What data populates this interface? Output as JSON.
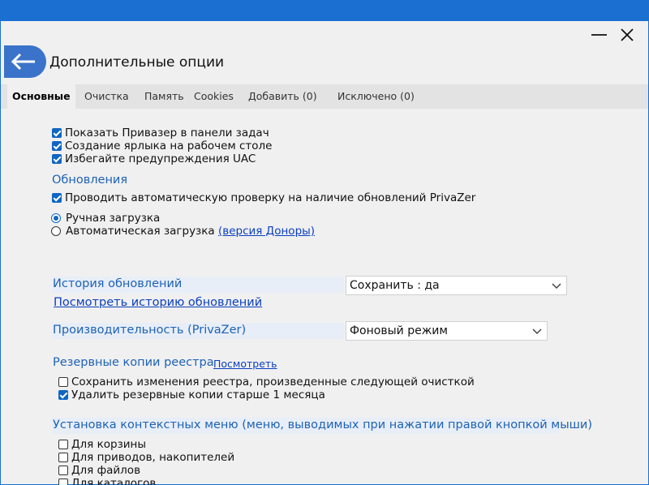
{
  "window": {
    "minimize_icon": "minimize-icon",
    "close_icon": "close-icon"
  },
  "header": {
    "title": "Дополнительные опции",
    "back_icon": "arrow-left-icon"
  },
  "tabs": [
    {
      "label": "Основные",
      "active": true
    },
    {
      "label": "Очистка"
    },
    {
      "label": "Память"
    },
    {
      "label": "Cookies"
    },
    {
      "label": "Добавить (0)"
    },
    {
      "label": "Исключено (0)"
    }
  ],
  "general": {
    "show_taskbar": {
      "label": "Показать Привазер в панели задач",
      "checked": true
    },
    "desktop_shortcut": {
      "label": "Создание ярлыка на рабочем столе",
      "checked": true
    },
    "avoid_uac": {
      "label": "Избегайте предупреждения UAC",
      "checked": true
    }
  },
  "updates": {
    "title": "Обновления",
    "auto_check": {
      "label": "Проводить автоматическую проверку на наличие обновлений PrivaZer",
      "checked": true
    },
    "manual_download": {
      "label": "Ручная загрузка",
      "selected": true
    },
    "auto_download": {
      "label": "Автоматическая загрузка",
      "link": "(версия Доноры)",
      "selected": false
    }
  },
  "update_history": {
    "title": "История обновлений",
    "select_value": "Сохранить : да",
    "view_link": "Посмотреть историю обновлений"
  },
  "performance": {
    "title": "Производительность (PrivaZer)",
    "select_value": "Фоновый режим"
  },
  "registry_backups": {
    "title": "Резервные копии реестра",
    "view_link": "Посмотреть",
    "save_changes": {
      "label": "Сохранить изменения реестра, произведенные следующей очисткой",
      "checked": false
    },
    "delete_old": {
      "label": "Удалить резервные копии старше 1 месяца",
      "checked": true
    }
  },
  "context_menu": {
    "title": "Установка контекстных меню (меню, выводимых при нажатии правой кнопкой мыши)",
    "recycle_bin": {
      "label": "Для корзины",
      "checked": false
    },
    "drives": {
      "label": "Для приводов, накопителей",
      "checked": false
    },
    "files": {
      "label": "Для файлов",
      "checked": false
    },
    "folders": {
      "label": "Для каталогов",
      "checked": false
    }
  },
  "colors": {
    "titlebar": "#1a6fd1",
    "accent": "#0f66c3",
    "section": "#1e62b5",
    "link": "#0a3fbf"
  }
}
